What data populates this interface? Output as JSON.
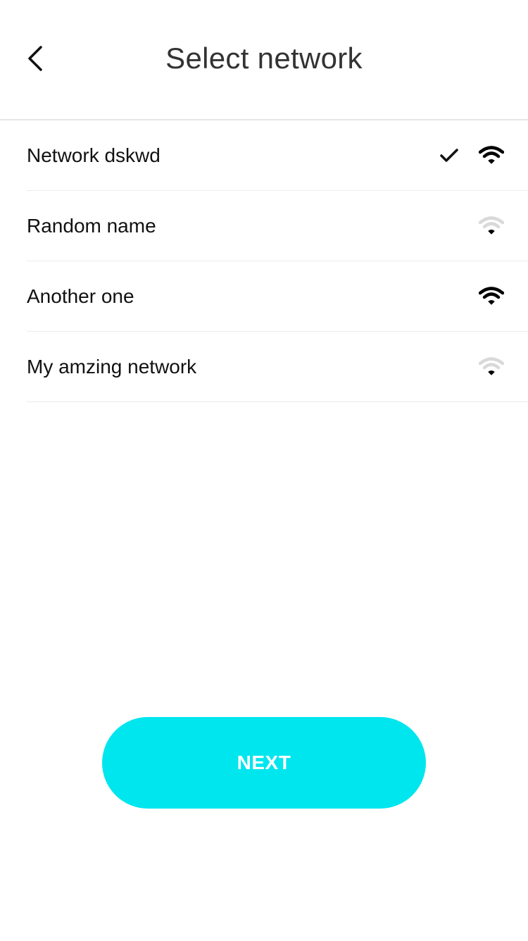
{
  "header": {
    "title": "Select network",
    "back_icon": "chevron-left-icon"
  },
  "networks": [
    {
      "name": "Network dskwd",
      "selected": true,
      "signal": "strong",
      "icon": "wifi-icon"
    },
    {
      "name": "Random name",
      "selected": false,
      "signal": "weak",
      "icon": "wifi-icon"
    },
    {
      "name": "Another one",
      "selected": false,
      "signal": "strong",
      "icon": "wifi-icon"
    },
    {
      "name": "My amzing network",
      "selected": false,
      "signal": "weak",
      "icon": "wifi-icon"
    }
  ],
  "next_button": {
    "label": "NEXT"
  },
  "colors": {
    "accent": "#00E6EE",
    "title": "#333333",
    "text": "#111111",
    "signal_strong": "#000000",
    "signal_weak": "#d9d9d9",
    "divider": "#ececec"
  }
}
